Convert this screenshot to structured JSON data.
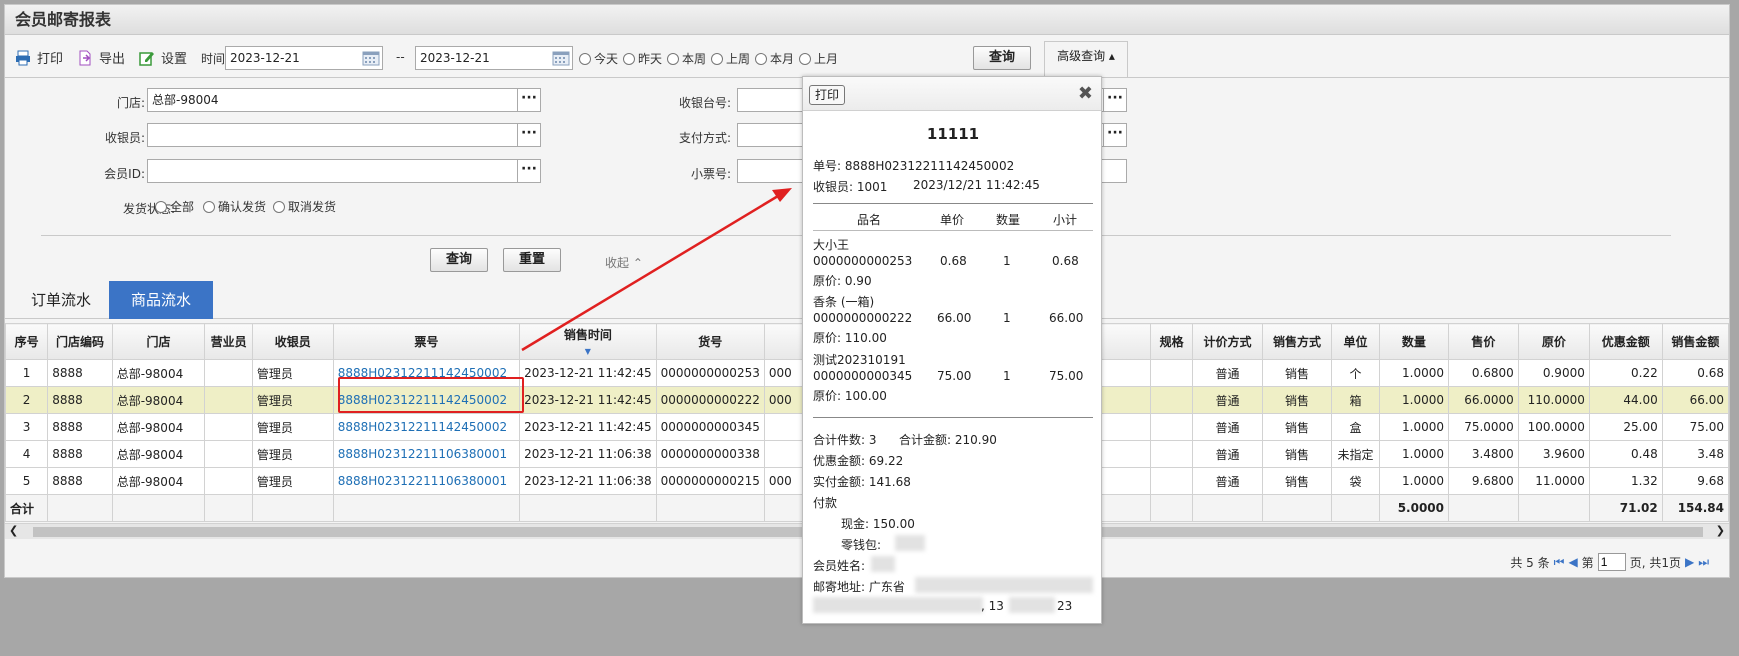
{
  "title": "会员邮寄报表",
  "toolbar": {
    "print": "打印",
    "export": "导出",
    "settings": "设置",
    "time_label": "时间",
    "date_from": "2023-12-21",
    "date_sep": "--",
    "date_to": "2023-12-21",
    "ranges": [
      "今天",
      "昨天",
      "本周",
      "上周",
      "本月",
      "上月"
    ],
    "query": "查询",
    "advanced": "高级查询"
  },
  "filters": {
    "store_label": "门店:",
    "store_value": "总部-98004",
    "cashier_label": "收银员:",
    "cashier_value": "",
    "member_label": "会员ID:",
    "member_value": "",
    "till_label": "收银台号:",
    "pay_label": "支付方式:",
    "ticket_label": "小票号:",
    "ship_label": "发货状态:",
    "ship_options": [
      "全部",
      "确认发货",
      "取消发货"
    ],
    "query": "查询",
    "reset": "重置",
    "collapse": "收起"
  },
  "tabs": [
    "订单流水",
    "商品流水"
  ],
  "table": {
    "headers": [
      "序号",
      "门店编码",
      "门店",
      "营业员",
      "收银员",
      "票号",
      "销售时间",
      "货号",
      "",
      "规格",
      "计价方式",
      "销售方式",
      "单位",
      "数量",
      "售价",
      "原价",
      "优惠金额",
      "销售金额"
    ],
    "rows": [
      [
        "1",
        "8888",
        "总部-98004",
        "",
        "管理员",
        "8888H02312211142450002",
        "2023-12-21 11:42:45",
        "0000000000253",
        "000",
        "",
        "普通",
        "销售",
        "个",
        "1.0000",
        "0.6800",
        "0.9000",
        "0.22",
        "0.68"
      ],
      [
        "2",
        "8888",
        "总部-98004",
        "",
        "管理员",
        "8888H02312211142450002",
        "2023-12-21 11:42:45",
        "0000000000222",
        "000",
        "",
        "普通",
        "销售",
        "箱",
        "1.0000",
        "66.0000",
        "110.0000",
        "44.00",
        "66.00"
      ],
      [
        "3",
        "8888",
        "总部-98004",
        "",
        "管理员",
        "8888H02312211142450002",
        "2023-12-21 11:42:45",
        "0000000000345",
        "",
        "",
        "普通",
        "销售",
        "盒",
        "1.0000",
        "75.0000",
        "100.0000",
        "25.00",
        "75.00"
      ],
      [
        "4",
        "8888",
        "总部-98004",
        "",
        "管理员",
        "8888H02312211106380001",
        "2023-12-21 11:06:38",
        "0000000000338",
        "",
        "",
        "普通",
        "销售",
        "未指定",
        "1.0000",
        "3.4800",
        "3.9600",
        "0.48",
        "3.48"
      ],
      [
        "5",
        "8888",
        "总部-98004",
        "",
        "管理员",
        "8888H02312211106380001",
        "2023-12-21 11:06:38",
        "0000000000215",
        "000",
        "",
        "普通",
        "销售",
        "袋",
        "1.0000",
        "9.6800",
        "11.0000",
        "1.32",
        "9.68"
      ]
    ],
    "footer_label": "合计",
    "footer_qty": "5.0000",
    "footer_discount": "71.02",
    "footer_sales": "154.84"
  },
  "pager": {
    "total": "共 5 条",
    "page_prefix": "第",
    "page_value": "1",
    "page_suffix": "页, 共1页"
  },
  "receipt": {
    "print": "打印",
    "title": "11111",
    "order_no": "单号: 8888H02312211142450002",
    "cashier": "收银员: 1001",
    "time": "2023/12/21 11:42:45",
    "headers": [
      "品名",
      "单价",
      "数量",
      "小计"
    ],
    "items": [
      {
        "name": "大小王",
        "code": "0000000000253",
        "price": "0.68",
        "qty": "1",
        "subtotal": "0.68",
        "orig": "原价: 0.90"
      },
      {
        "name": "香条 (一箱)",
        "code": "0000000000222",
        "price": "66.00",
        "qty": "1",
        "subtotal": "66.00",
        "orig": "原价: 110.00"
      },
      {
        "name": "测试202310191",
        "code": "0000000000345",
        "price": "75.00",
        "qty": "1",
        "subtotal": "75.00",
        "orig": "原价: 100.00"
      }
    ],
    "total_count": "合计件数: 3",
    "total_amount": "合计金额: 210.90",
    "discount": "优惠金额: 69.22",
    "paid": "实付金额: 141.68",
    "payment": "付款",
    "cash": "现金: 150.00",
    "wallet": "零钱包:",
    "member_name": "会员姓名:",
    "address": "邮寄地址: 广东省",
    "phone_fragment": ", 13",
    "phone_end": "23"
  },
  "colors": {
    "accent": "#3b74c6",
    "link": "#1e6fb5",
    "highlight_row": "#efefc6",
    "annotation": "#e02020"
  }
}
